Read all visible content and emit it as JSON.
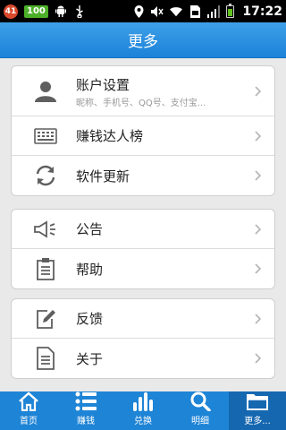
{
  "statusbar": {
    "notification_count": "41",
    "app_badge": "100",
    "time": "17:22"
  },
  "header": {
    "title": "更多"
  },
  "groups": [
    {
      "items": [
        {
          "label": "账户设置",
          "sub": "昵称、手机号、QQ号、支付宝...",
          "icon": "user-icon"
        },
        {
          "label": "赚钱达人榜",
          "icon": "keyboard-icon"
        },
        {
          "label": "软件更新",
          "icon": "refresh-icon"
        }
      ]
    },
    {
      "items": [
        {
          "label": "公告",
          "icon": "megaphone-icon"
        },
        {
          "label": "帮助",
          "icon": "clipboard-icon"
        }
      ]
    },
    {
      "items": [
        {
          "label": "反馈",
          "icon": "edit-icon"
        },
        {
          "label": "关于",
          "icon": "document-icon"
        }
      ]
    }
  ],
  "tabs": [
    {
      "label": "首页",
      "icon": "home-icon"
    },
    {
      "label": "赚钱",
      "icon": "list-icon"
    },
    {
      "label": "兑换",
      "icon": "bar-chart-icon"
    },
    {
      "label": "明细",
      "icon": "search-icon"
    },
    {
      "label": "更多...",
      "icon": "folder-icon",
      "active": true
    }
  ],
  "colors": {
    "titlebar": "#1b82d8",
    "tabbar": "#1e84d6",
    "tab_active": "#1567b0",
    "icon_gray": "#5f5f5f"
  }
}
